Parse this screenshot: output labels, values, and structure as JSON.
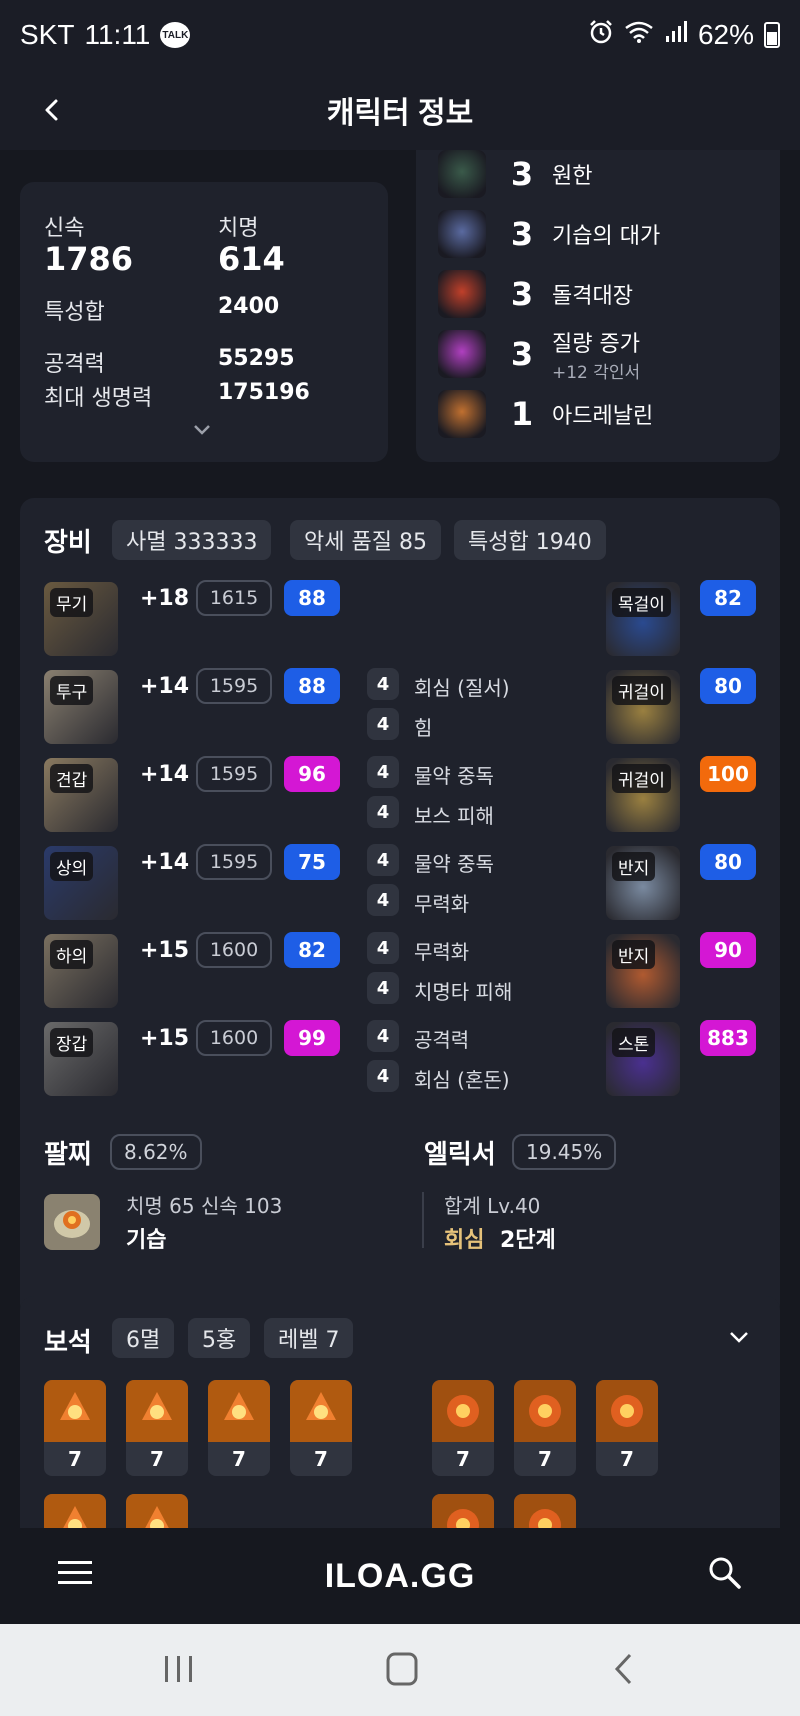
{
  "status_bar": {
    "carrier": "SKT",
    "time": "11:11",
    "talk_label": "TALK",
    "battery": "62%"
  },
  "app_bar": {
    "title": "캐릭터 정보"
  },
  "stats": {
    "swift_label": "신속",
    "swift_value": "1786",
    "crit_label": "치명",
    "crit_value": "614",
    "trait_sum_label": "특성합",
    "trait_sum_value": "2400",
    "attack_label": "공격력",
    "attack_value": "55295",
    "max_hp_label": "최대 생명력",
    "max_hp_value": "175196"
  },
  "engravings": [
    {
      "level": "3",
      "name": "원한",
      "sub": "",
      "color": "#3a5a4a"
    },
    {
      "level": "3",
      "name": "기습의 대가",
      "sub": "",
      "color": "#5a6aa0"
    },
    {
      "level": "3",
      "name": "돌격대장",
      "sub": "",
      "color": "#c0402a"
    },
    {
      "level": "3",
      "name": "질량 증가",
      "sub": "+12 각인서",
      "color": "#b040c0"
    },
    {
      "level": "1",
      "name": "아드레날린",
      "sub": "",
      "color": "#c07030"
    }
  ],
  "equipment": {
    "title": "장비",
    "chips": [
      "사멸 333333",
      "악세 품질 85",
      "특성합 1940"
    ],
    "gear": [
      {
        "tag": "무기",
        "plus": "+18",
        "ilvl": "1615",
        "quality": "88",
        "qcolor": "#1e5ee6"
      },
      {
        "tag": "투구",
        "plus": "+14",
        "ilvl": "1595",
        "quality": "88",
        "qcolor": "#1e5ee6"
      },
      {
        "tag": "견갑",
        "plus": "+14",
        "ilvl": "1595",
        "quality": "96",
        "qcolor": "#d417d4"
      },
      {
        "tag": "상의",
        "plus": "+14",
        "ilvl": "1595",
        "quality": "75",
        "qcolor": "#1e5ee6"
      },
      {
        "tag": "하의",
        "plus": "+15",
        "ilvl": "1600",
        "quality": "82",
        "qcolor": "#1e5ee6"
      },
      {
        "tag": "장갑",
        "plus": "+15",
        "ilvl": "1600",
        "quality": "99",
        "qcolor": "#d417d4"
      }
    ],
    "options": [
      {
        "level": "4",
        "name": "회심 (질서)"
      },
      {
        "level": "4",
        "name": "힘"
      },
      {
        "level": "4",
        "name": "물약 중독"
      },
      {
        "level": "4",
        "name": "보스 피해"
      },
      {
        "level": "4",
        "name": "물약 중독"
      },
      {
        "level": "4",
        "name": "무력화"
      },
      {
        "level": "4",
        "name": "무력화"
      },
      {
        "level": "4",
        "name": "치명타 피해"
      },
      {
        "level": "4",
        "name": "공격력"
      },
      {
        "level": "4",
        "name": "회심 (혼돈)"
      }
    ],
    "accessories": [
      {
        "tag": "목걸이",
        "quality": "82",
        "qcolor": "#1e5ee6"
      },
      {
        "tag": "귀걸이",
        "quality": "80",
        "qcolor": "#1e5ee6"
      },
      {
        "tag": "귀걸이",
        "quality": "100",
        "qcolor": "#f26a0c"
      },
      {
        "tag": "반지",
        "quality": "80",
        "qcolor": "#1e5ee6"
      },
      {
        "tag": "반지",
        "quality": "90",
        "qcolor": "#d417d4"
      },
      {
        "tag": "스톤",
        "quality": "883",
        "qcolor": "#d417d4"
      }
    ]
  },
  "bracelet": {
    "title": "팔찌",
    "percent": "8.62%",
    "stats": "치명 65  신속 103",
    "effect": "기습"
  },
  "elixir": {
    "title": "엘릭서",
    "percent": "19.45%",
    "total": "합계 Lv.40",
    "set_name": "회심",
    "set_level": "2단계"
  },
  "gems": {
    "title": "보석",
    "chips": [
      "6멸",
      "5홍",
      "레벨 7"
    ],
    "row1_left": [
      "7",
      "7",
      "7",
      "7"
    ],
    "row1_right": [
      "7",
      "7",
      "7"
    ]
  },
  "bottom_bar": {
    "logo": "ILOA.GG"
  },
  "colors": {
    "background": "#16181f",
    "card": "#1f222c",
    "blue_quality": "#1e5ee6",
    "magenta_quality": "#d417d4",
    "orange_quality": "#f26a0c",
    "elixir_gold": "#e6c27a"
  }
}
